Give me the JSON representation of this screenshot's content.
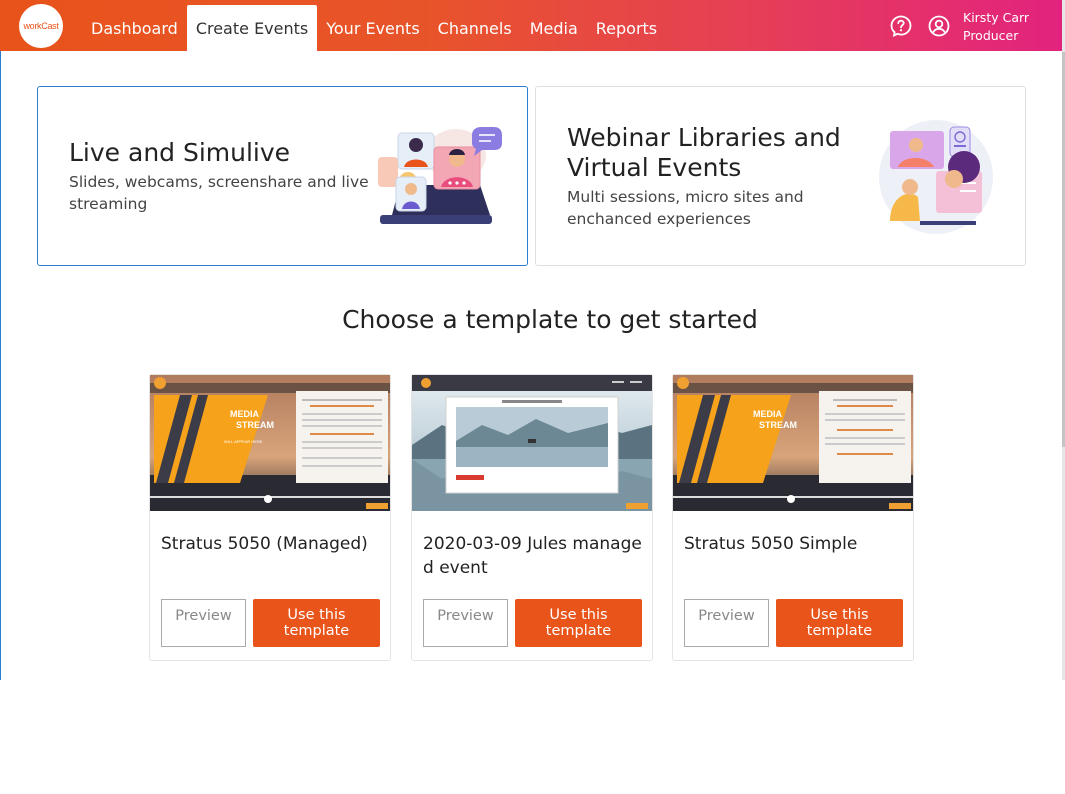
{
  "app": {
    "logo_text": "workCast"
  },
  "nav": {
    "items": [
      {
        "label": "Dashboard"
      },
      {
        "label": "Create Events"
      },
      {
        "label": "Your Events"
      },
      {
        "label": "Channels"
      },
      {
        "label": "Media"
      },
      {
        "label": "Reports"
      }
    ],
    "active": "Create Events"
  },
  "user": {
    "name": "Kirsty Carr",
    "role": "Producer"
  },
  "event_types": [
    {
      "title": "Live and Simulive",
      "description": "Slides, webcams, screenshare and live streaming",
      "selected": true
    },
    {
      "title": "Webinar Libraries and Virtual Events",
      "description": "Multi sessions, micro sites and enchanced experiences",
      "selected": false
    }
  ],
  "templates_heading": "Choose a template to get started",
  "templates": [
    {
      "name": "Stratus 5050 (Managed)",
      "preview_label": "Preview",
      "use_label": "Use this template",
      "thumb_overlay": "MEDIA STREAM",
      "thumb_sub": "WILL APPEAR HERE"
    },
    {
      "name": "2020-03-09 Jules manage d event",
      "preview_label": "Preview",
      "use_label": "Use this template"
    },
    {
      "name": "Stratus 5050 Simple",
      "preview_label": "Preview",
      "use_label": "Use this template",
      "thumb_overlay": "MEDIA STREAM"
    }
  ],
  "colors": {
    "accent": "#e8541a",
    "selected_border": "#2a7fd1"
  }
}
